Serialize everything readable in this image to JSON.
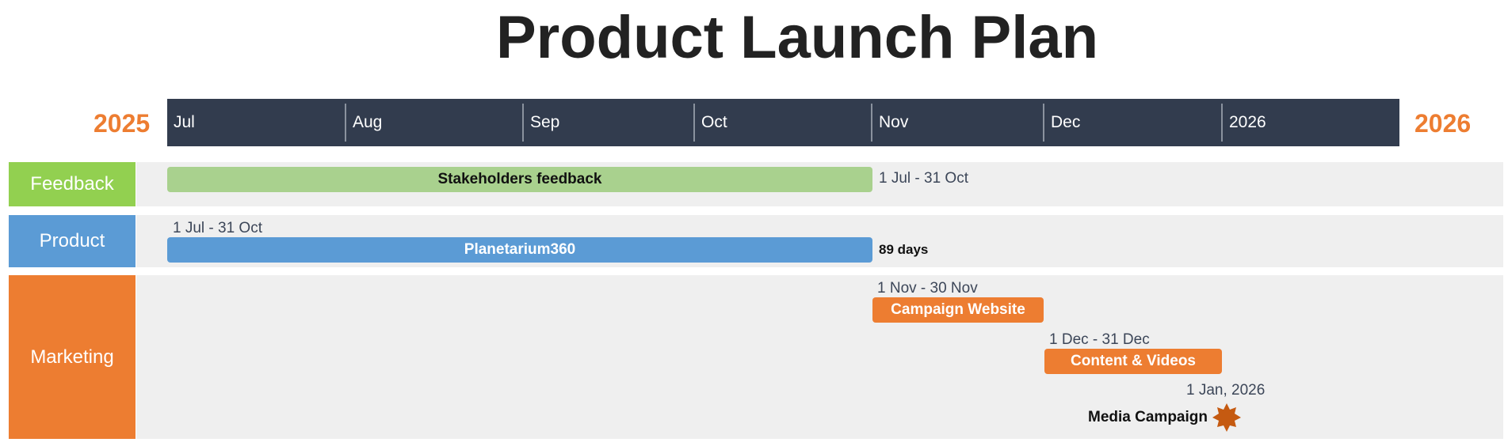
{
  "title": "Product Launch Plan",
  "years": {
    "start": "2025",
    "end": "2026"
  },
  "months": [
    "Jul",
    "Aug",
    "Sep",
    "Oct",
    "Nov",
    "Dec",
    "2026"
  ],
  "colors": {
    "scale_bg": "#323C4E",
    "feedback": "#92D050",
    "feedback_bar": "#A9D18E",
    "product": "#5B9BD5",
    "marketing": "#ED7D31",
    "milestone": "#C55A11",
    "year_text": "#ED7D31"
  },
  "rows": {
    "feedback": {
      "label": "Feedback",
      "task": {
        "name": "Stakeholders feedback",
        "dates": "1 Jul - 31 Oct"
      }
    },
    "product": {
      "label": "Product",
      "task": {
        "name": "Planetarium360",
        "dates": "1 Jul - 31 Oct",
        "duration": "89 days"
      }
    },
    "marketing": {
      "label": "Marketing",
      "tasks": [
        {
          "name": "Campaign Website",
          "dates": "1 Nov - 30 Nov"
        },
        {
          "name": "Content & Videos",
          "dates": "1 Dec - 31 Dec"
        }
      ],
      "milestone": {
        "name": "Media Campaign",
        "date": "1 Jan, 2026",
        "icon": "starburst-icon"
      }
    }
  }
}
